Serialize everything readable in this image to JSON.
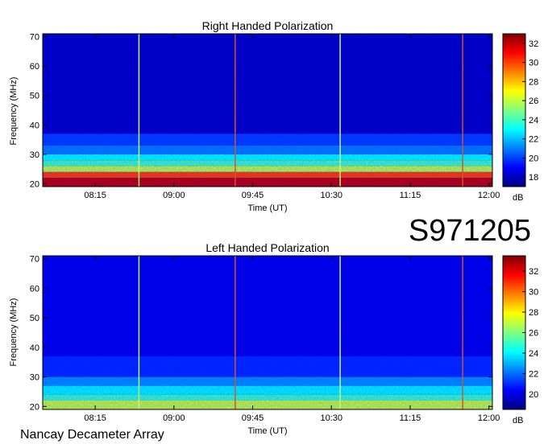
{
  "observation_id": "S971205",
  "footer_label": "Nancay Decameter Array",
  "colors": {
    "scale": [
      "#00007f",
      "#0000ff",
      "#007fff",
      "#00ffff",
      "#7fff7f",
      "#ffff00",
      "#ff7f00",
      "#ff0000",
      "#7f0000"
    ]
  },
  "chart_data": [
    {
      "type": "heatmap",
      "title": "Right Handed Polarization",
      "xlabel": "Time (UT)",
      "ylabel": "Frequency (MHz)",
      "xticks": [
        "08:15",
        "09:00",
        "09:45",
        "10:30",
        "11:15",
        "12:00"
      ],
      "xlim": [
        "07:45",
        "12:02"
      ],
      "yticks": [
        20,
        30,
        40,
        50,
        60,
        70
      ],
      "ylim": [
        19,
        71
      ],
      "colorbar": {
        "label": "dB",
        "ticks": [
          18,
          20,
          22,
          24,
          26,
          28,
          30,
          32
        ],
        "range": [
          17,
          33
        ]
      },
      "vertical_lines": [
        "08:40",
        "09:35",
        "10:35",
        "11:45"
      ],
      "bands_mhz": [
        {
          "lo": 19,
          "hi": 22,
          "level": 32
        },
        {
          "lo": 22,
          "hi": 24,
          "level": 30
        },
        {
          "lo": 24,
          "hi": 26,
          "level": 26
        },
        {
          "lo": 26,
          "hi": 28,
          "level": 24
        },
        {
          "lo": 28,
          "hi": 30,
          "level": 23
        },
        {
          "lo": 30,
          "hi": 33,
          "level": 21
        },
        {
          "lo": 33,
          "hi": 37,
          "level": 20
        },
        {
          "lo": 37,
          "hi": 71,
          "level": 18
        }
      ]
    },
    {
      "type": "heatmap",
      "title": "Left Handed Polarization",
      "xlabel": "Time (UT)",
      "ylabel": "Frequency (MHz)",
      "xticks": [
        "08:15",
        "09:00",
        "09:45",
        "10:30",
        "11:15",
        "12:00"
      ],
      "xlim": [
        "07:45",
        "12:02"
      ],
      "yticks": [
        20,
        30,
        40,
        50,
        60,
        70
      ],
      "ylim": [
        19,
        71
      ],
      "colorbar": {
        "label": "dB",
        "ticks": [
          20,
          22,
          24,
          26,
          28,
          30,
          32
        ],
        "range": [
          18.5,
          33.5
        ]
      },
      "vertical_lines": [
        "08:40",
        "09:35",
        "10:35",
        "11:45"
      ],
      "bands_mhz": [
        {
          "lo": 19,
          "hi": 22,
          "level": 27
        },
        {
          "lo": 22,
          "hi": 24,
          "level": 25
        },
        {
          "lo": 24,
          "hi": 27,
          "level": 24
        },
        {
          "lo": 27,
          "hi": 30,
          "level": 22.5
        },
        {
          "lo": 30,
          "hi": 37,
          "level": 21
        },
        {
          "lo": 37,
          "hi": 71,
          "level": 20
        }
      ]
    }
  ]
}
